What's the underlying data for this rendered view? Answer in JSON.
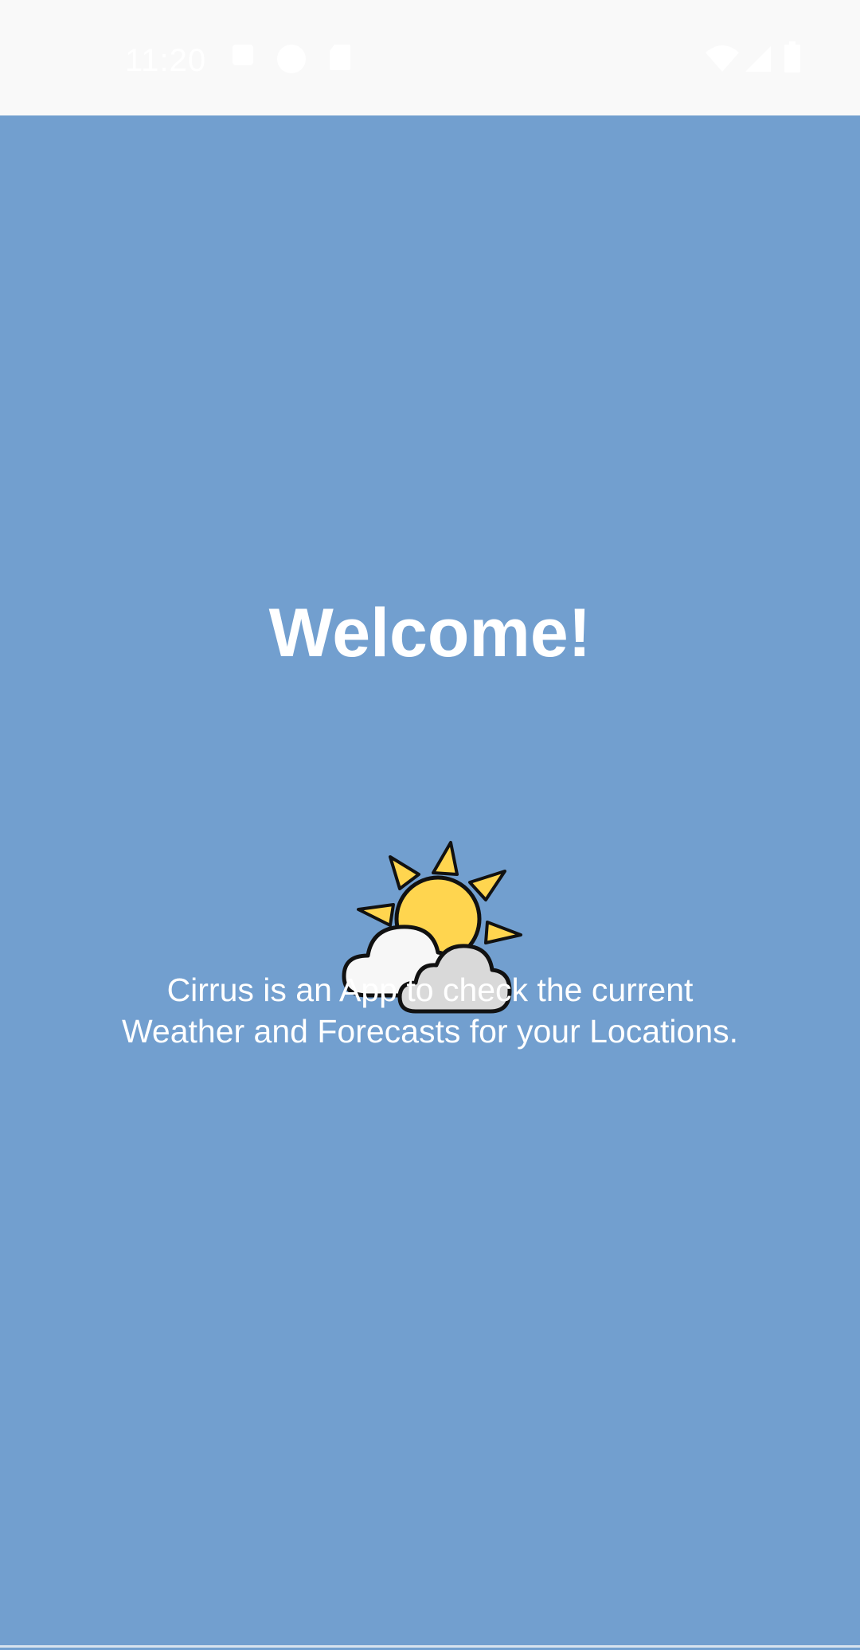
{
  "status_bar": {
    "time": "11:20",
    "left_icons": [
      "notification-a-icon",
      "notification-p-icon",
      "sd-card-icon"
    ],
    "right_icons": [
      "wifi-icon",
      "cell-signal-icon",
      "battery-icon"
    ]
  },
  "welcome": {
    "title": "Welcome!",
    "illustration": "partly-cloudy-icon",
    "description_line1": "Cirrus is an App to check the current",
    "description_line2": "Weather and Forecasts for your Locations."
  },
  "colors": {
    "background": "#729fcf",
    "status_bar": "#f9f9f9",
    "text": "#ffffff",
    "sun": "#ffd54f",
    "cloud_front": "#f7f7f7",
    "cloud_back": "#d9d9d9"
  }
}
